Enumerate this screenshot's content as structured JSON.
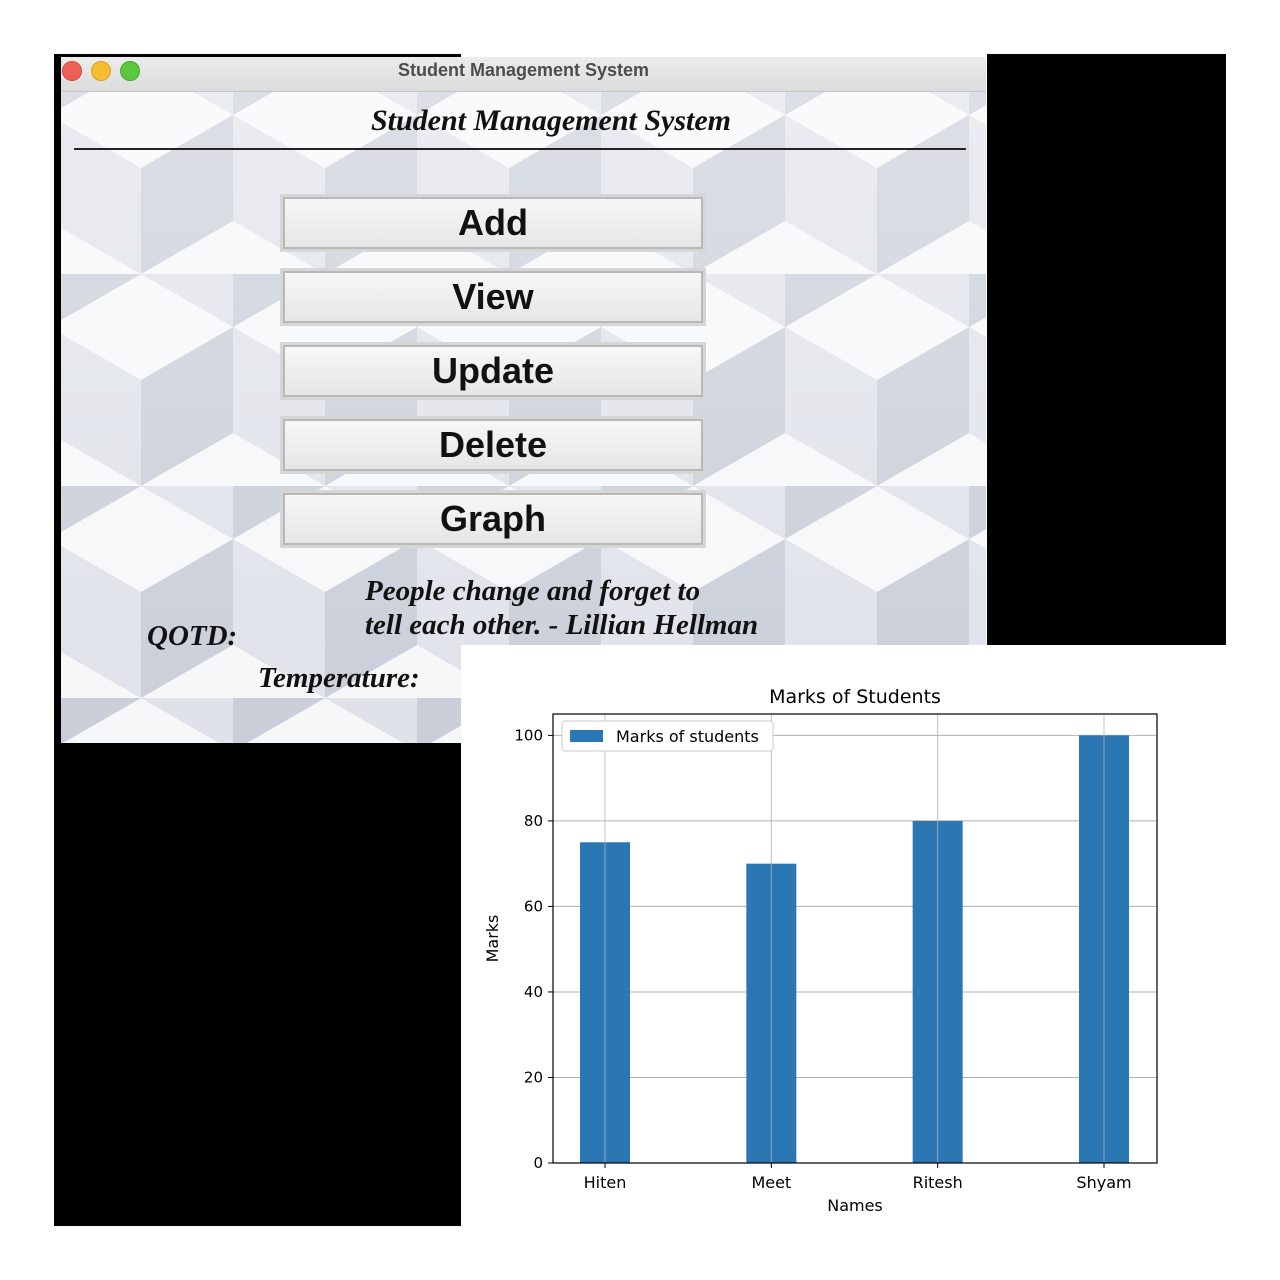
{
  "window": {
    "title": "Student Management System"
  },
  "app": {
    "heading": "Student Management System",
    "buttons": {
      "add": "Add",
      "view": "View",
      "update": "Update",
      "delete": "Delete",
      "graph": "Graph"
    },
    "qotd_label": "QOTD:",
    "qotd_line1": "People change and forget to",
    "qotd_line2": "tell each other. - Lillian Hellman",
    "temperature_label": "Temperature:"
  },
  "colors": {
    "bar": "#2a77b4",
    "traffic_close": "#ee5f58",
    "traffic_minimize": "#f5bd2f",
    "traffic_maximize": "#5bc73e"
  },
  "chart_data": {
    "type": "bar",
    "title": "Marks of Students",
    "xlabel": "Names",
    "ylabel": "Marks",
    "categories": [
      "Hiten",
      "Meet",
      "Ritesh",
      "Shyam"
    ],
    "series": [
      {
        "name": "Marks of students",
        "values": [
          75,
          70,
          80,
          100
        ]
      }
    ],
    "ylim": [
      0,
      105
    ],
    "yticks": [
      0,
      20,
      40,
      60,
      80,
      100
    ],
    "grid": true,
    "legend_position": "upper-left"
  }
}
